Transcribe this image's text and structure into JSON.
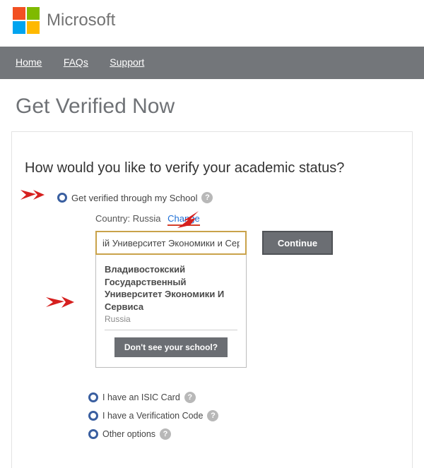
{
  "brand": "Microsoft",
  "nav": {
    "home": "Home",
    "faqs": "FAQs",
    "support": "Support"
  },
  "page_title": "Get Verified Now",
  "question": "How would you like to verify your academic status?",
  "option_school": "Get verified through my School",
  "country_label": "Country:",
  "country_value": "Russia",
  "change_label": "Change",
  "search_value": "ій Университет Экономики и Сервиса",
  "continue_label": "Continue",
  "dropdown": {
    "name": "Владивостокский Государственный Университет Экономики И Сервиса",
    "country": "Russia",
    "missing": "Don't see your school?"
  },
  "option_isic": "I have an ISIC Card",
  "option_code": "I have a Verification Code",
  "option_other": "Other options",
  "help_glyph": "?"
}
